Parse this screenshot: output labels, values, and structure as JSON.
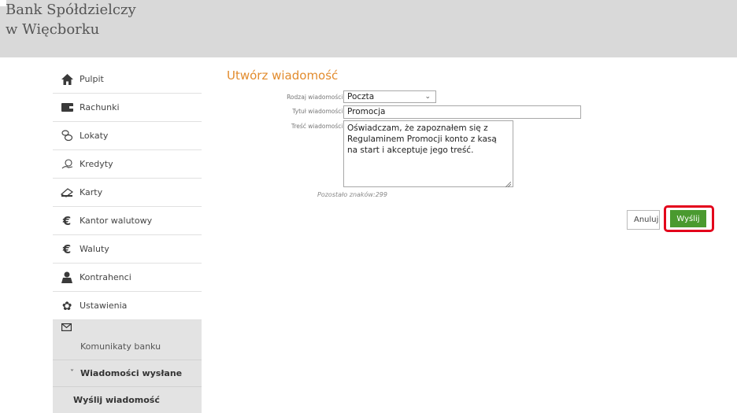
{
  "header": {
    "brand_line1": "Bank Spółdzielczy",
    "brand_line2": "w Więcborku"
  },
  "sidebar": {
    "items": [
      {
        "label": "Pulpit",
        "icon": "home-icon"
      },
      {
        "label": "Rachunki",
        "icon": "wallet-icon"
      },
      {
        "label": "Lokaty",
        "icon": "coins-icon"
      },
      {
        "label": "Kredyty",
        "icon": "hand-money-icon"
      },
      {
        "label": "Karty",
        "icon": "card-icon"
      },
      {
        "label": "Kantor walutowy",
        "icon": "euro-icon"
      },
      {
        "label": "Waluty",
        "icon": "euro-icon"
      },
      {
        "label": "Kontrahenci",
        "icon": "person-icon"
      },
      {
        "label": "Ustawienia",
        "icon": "gear-icon"
      }
    ],
    "messages_icon": "envelope-icon",
    "sub_items": [
      {
        "label": "Komunikaty banku"
      },
      {
        "label": "Wiadomości wysłane"
      },
      {
        "label": "Wyślij wiadomość"
      }
    ]
  },
  "form": {
    "title": "Utwórz wiadomość",
    "type_label": "Rodzaj wiadomości:",
    "type_value": "Poczta",
    "subject_label": "Tytuł wiadomości:",
    "subject_value": "Promocja",
    "body_label": "Treść wiadomości:",
    "body_value": "Oświadczam, że zapoznałem się z Regulaminem Promocji  konto z kasą na start  i akceptuje jego treść.",
    "remaining_chars": "Pozostało znaków:299",
    "cancel_label": "Anuluj",
    "send_label": "Wyślij"
  },
  "colors": {
    "accent": "#e28b2d",
    "send_button": "#4a9a2f",
    "highlight": "#e3001b",
    "header_bg": "#d9d9d9"
  }
}
